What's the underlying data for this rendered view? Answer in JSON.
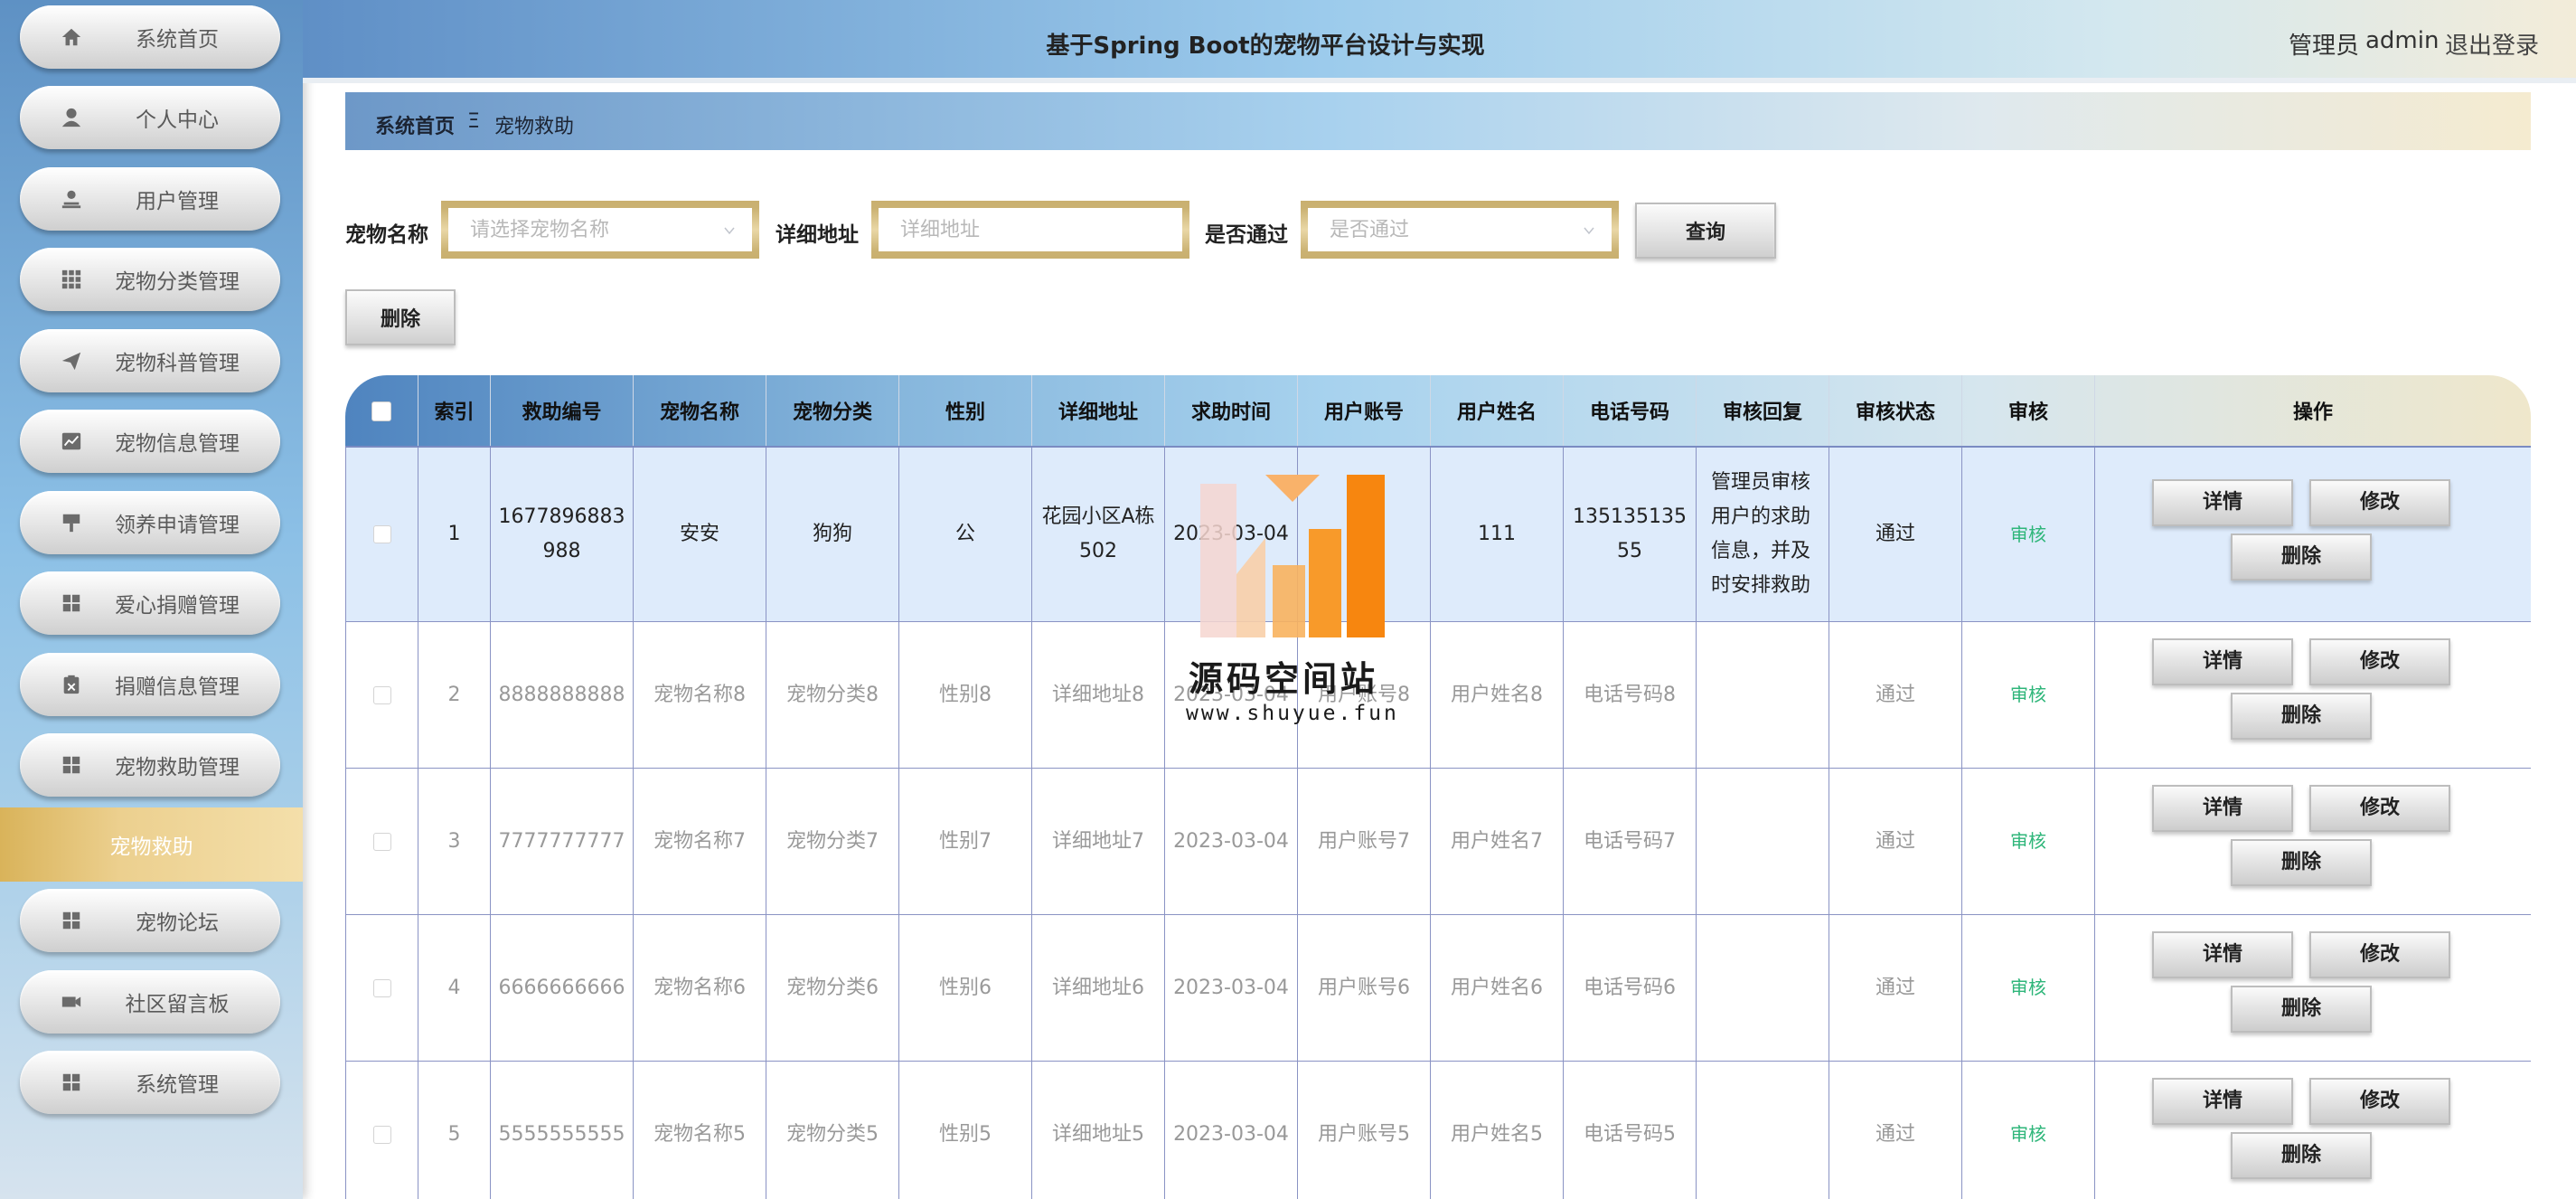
{
  "header": {
    "title": "基于Spring Boot的宠物平台设计与实现",
    "user_role": "管理员",
    "user_name": "admin",
    "logout_label": "退出登录"
  },
  "sidebar": {
    "items": [
      {
        "label": "系统首页",
        "icon": "home-icon"
      },
      {
        "label": "个人中心",
        "icon": "user-icon"
      },
      {
        "label": "用户管理",
        "icon": "user-manage-icon"
      },
      {
        "label": "宠物分类管理",
        "icon": "grid-icon"
      },
      {
        "label": "宠物科普管理",
        "icon": "send-icon"
      },
      {
        "label": "宠物信息管理",
        "icon": "chart-icon"
      },
      {
        "label": "领养申请管理",
        "icon": "flag-icon"
      },
      {
        "label": "爱心捐赠管理",
        "icon": "apps-icon"
      },
      {
        "label": "捐赠信息管理",
        "icon": "clipboard-icon"
      },
      {
        "label": "宠物救助管理",
        "icon": "apps-icon"
      },
      {
        "label": "宠物救助",
        "icon": "",
        "active": true
      },
      {
        "label": "宠物论坛",
        "icon": "apps-icon"
      },
      {
        "label": "社区留言板",
        "icon": "video-icon"
      },
      {
        "label": "系统管理",
        "icon": "apps-icon"
      }
    ]
  },
  "breadcrumb": {
    "home": "系统首页",
    "separator": "Ξ",
    "current": "宠物救助"
  },
  "search": {
    "pet_name_label": "宠物名称",
    "pet_name_placeholder": "请选择宠物名称",
    "address_label": "详细地址",
    "address_placeholder": "详细地址",
    "passed_label": "是否通过",
    "passed_placeholder": "是否通过",
    "query_label": "查询"
  },
  "toolbar": {
    "delete_label": "删除"
  },
  "table": {
    "columns": [
      "",
      "索引",
      "救助编号",
      "宠物名称",
      "宠物分类",
      "性别",
      "详细地址",
      "求助时间",
      "用户账号",
      "用户姓名",
      "电话号码",
      "审核回复",
      "审核状态",
      "审核",
      "操作"
    ],
    "rows": [
      {
        "index": "1",
        "rescue_no": "1677896883988",
        "pet_name": "安安",
        "pet_category": "狗狗",
        "gender": "公",
        "address": "花园小区A栋502",
        "time": "2023-03-04",
        "account": "11",
        "name": "111",
        "phone": "13513513555",
        "reply": "管理员审核用户的求助信息，并及时安排救助",
        "status": "通过",
        "audit": "审核"
      },
      {
        "index": "2",
        "rescue_no": "8888888888",
        "pet_name": "宠物名称8",
        "pet_category": "宠物分类8",
        "gender": "性别8",
        "address": "详细地址8",
        "time": "2023-03-04",
        "account": "用户账号8",
        "name": "用户姓名8",
        "phone": "电话号码8",
        "reply": "",
        "status": "通过",
        "audit": "审核"
      },
      {
        "index": "3",
        "rescue_no": "7777777777",
        "pet_name": "宠物名称7",
        "pet_category": "宠物分类7",
        "gender": "性别7",
        "address": "详细地址7",
        "time": "2023-03-04",
        "account": "用户账号7",
        "name": "用户姓名7",
        "phone": "电话号码7",
        "reply": "",
        "status": "通过",
        "audit": "审核"
      },
      {
        "index": "4",
        "rescue_no": "6666666666",
        "pet_name": "宠物名称6",
        "pet_category": "宠物分类6",
        "gender": "性别6",
        "address": "详细地址6",
        "time": "2023-03-04",
        "account": "用户账号6",
        "name": "用户姓名6",
        "phone": "电话号码6",
        "reply": "",
        "status": "通过",
        "audit": "审核"
      },
      {
        "index": "5",
        "rescue_no": "5555555555",
        "pet_name": "宠物名称5",
        "pet_category": "宠物分类5",
        "gender": "性别5",
        "address": "详细地址5",
        "time": "2023-03-04",
        "account": "用户账号5",
        "name": "用户姓名5",
        "phone": "电话号码5",
        "reply": "",
        "status": "通过",
        "audit": "审核"
      }
    ],
    "actions": {
      "detail_label": "详情",
      "edit_label": "修改",
      "delete_label": "删除"
    }
  },
  "watermark": {
    "text": "源码空间站",
    "url": "www.shuyue.fun"
  },
  "colors": {
    "active_menu": "#e2c274",
    "audit_link": "#2fb67a",
    "header_start": "#5f8fc6"
  }
}
